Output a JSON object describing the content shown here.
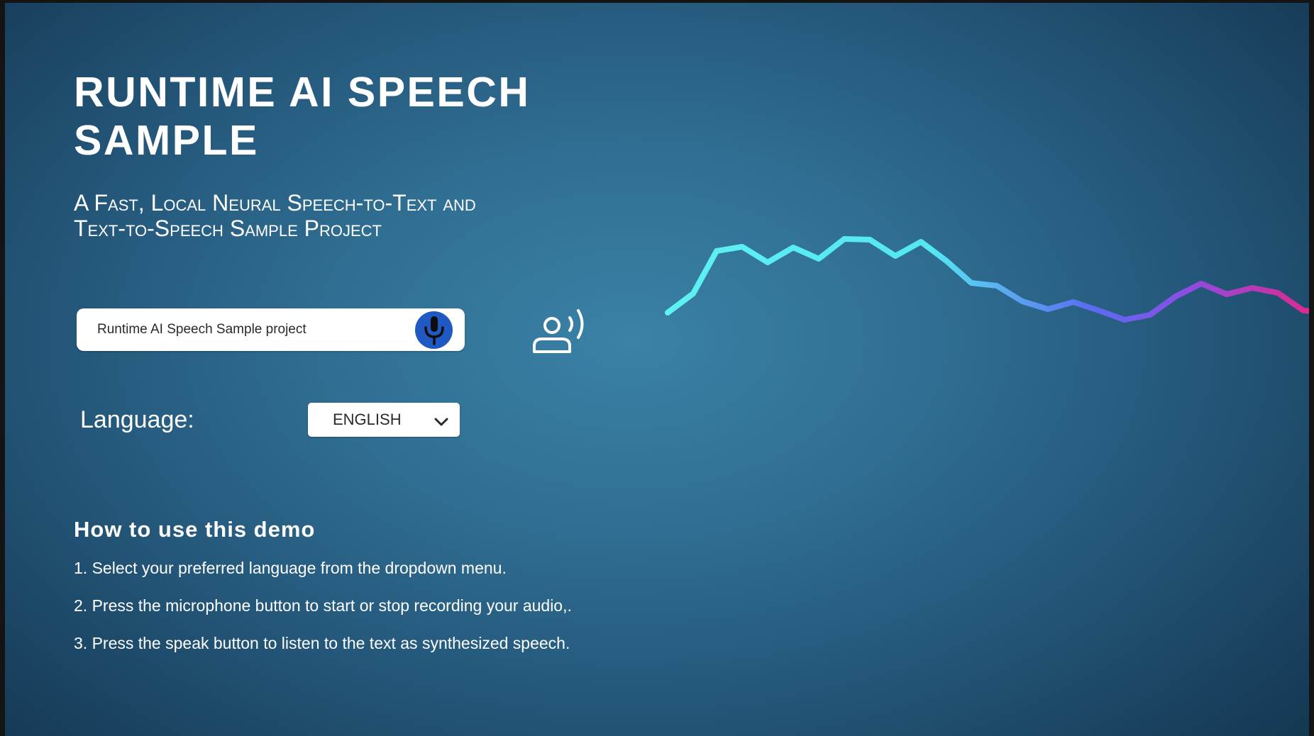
{
  "header": {
    "title": "RUNTIME AI SPEECH\nSAMPLE",
    "subtitle": "A Fast, Local Neural Speech-to-Text and\nText-to-Speech Sample Project"
  },
  "transcription": {
    "text": "Runtime AI Speech Sample project",
    "mic_icon": "microphone-icon"
  },
  "speak": {
    "icon": "speaking-person-icon"
  },
  "language": {
    "label": "Language:",
    "selected": "ENGLISH",
    "chevron_icon": "chevron-down-icon"
  },
  "instructions": {
    "heading": "How to use this demo",
    "steps": [
      "1. Select your preferred language from the dropdown menu.",
      "2. Press the microphone button to start or stop recording your audio,.",
      "3. Press the speak button to listen to the text as synthesized speech."
    ]
  },
  "colors": {
    "background_center": "#3a82a6",
    "background_edge": "#133449",
    "mic_button": "#2159c4",
    "wave_start": "#5ef2f2",
    "wave_mid": "#5a6cf0",
    "wave_end": "#e0288c"
  }
}
